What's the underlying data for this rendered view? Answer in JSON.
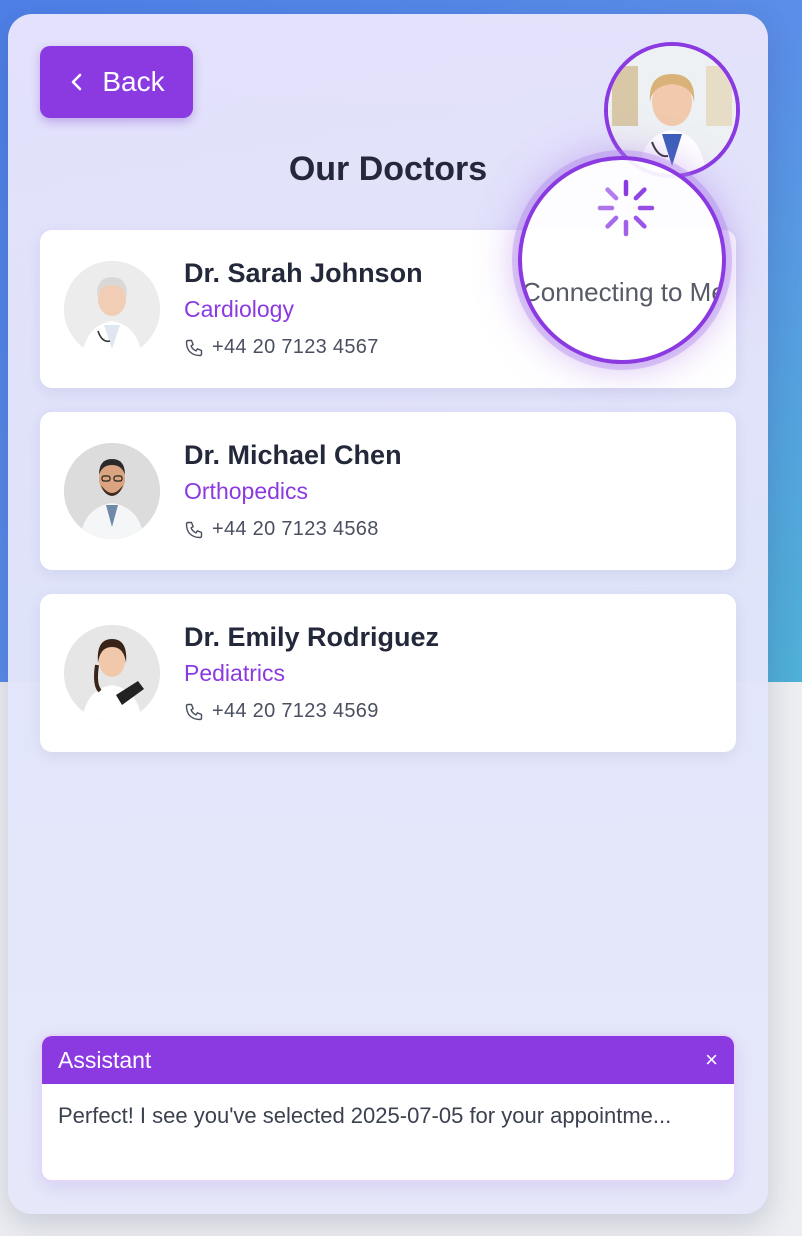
{
  "page": {
    "title": "Our Doctors",
    "back_label": "Back"
  },
  "doctors": [
    {
      "name": "Dr. Sarah Johnson",
      "specialty": "Cardiology",
      "phone": "+44 20 7123 4567"
    },
    {
      "name": "Dr. Michael Chen",
      "specialty": "Orthopedics",
      "phone": "+44 20 7123 4568"
    },
    {
      "name": "Dr. Emily Rodriguez",
      "specialty": "Pediatrics",
      "phone": "+44 20 7123 4569"
    }
  ],
  "connecting": {
    "text": "Connecting to Medcor AI..."
  },
  "assistant": {
    "header": "Assistant",
    "close": "×",
    "message": "Perfect! I see you've selected 2025-07-05 for your appointme..."
  },
  "colors": {
    "accent": "#8b3ae2",
    "title": "#23283a"
  },
  "icons": [
    "chevron-left-icon",
    "phone-icon",
    "spinner-icon",
    "close-icon"
  ]
}
